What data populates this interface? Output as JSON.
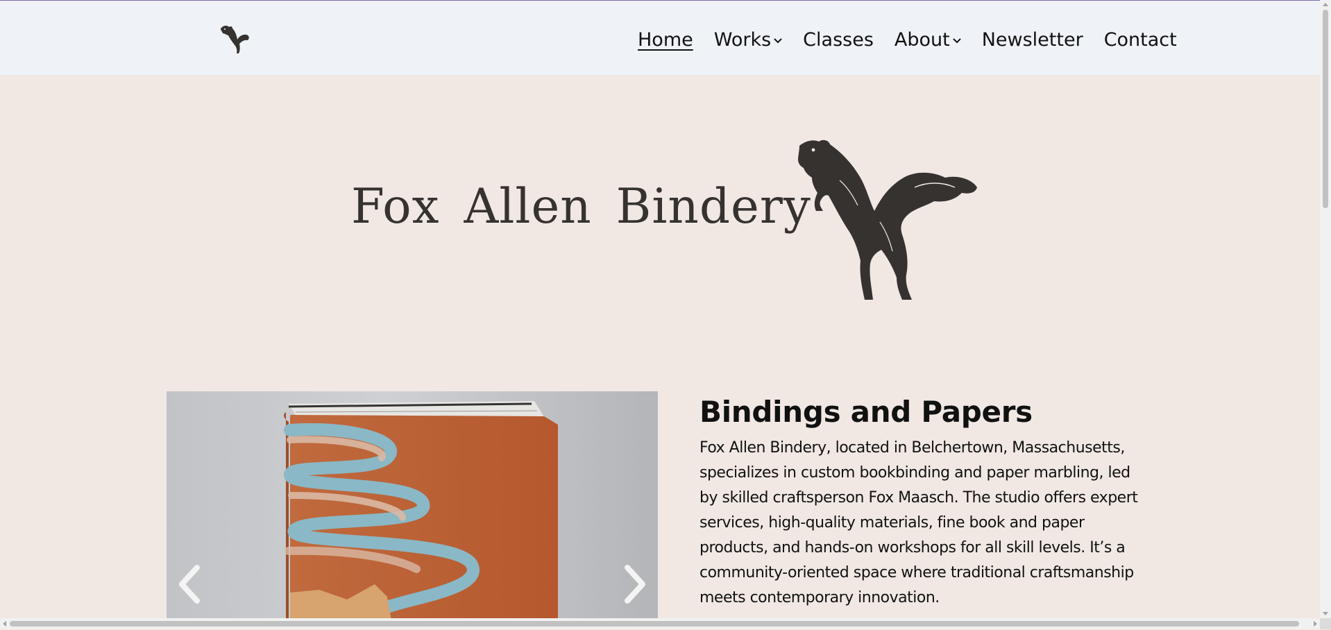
{
  "header": {
    "logo_icon": "leaping-fox-icon",
    "nav": [
      {
        "label": "Home",
        "active": true,
        "has_dropdown": false
      },
      {
        "label": "Works",
        "active": false,
        "has_dropdown": true
      },
      {
        "label": "Classes",
        "active": false,
        "has_dropdown": false
      },
      {
        "label": "About",
        "active": false,
        "has_dropdown": true
      },
      {
        "label": "Newsletter",
        "active": false,
        "has_dropdown": false
      },
      {
        "label": "Contact",
        "active": false,
        "has_dropdown": false
      }
    ]
  },
  "hero": {
    "title": "Fox Allen Bindery",
    "logo_icon": "leaping-fox-icon"
  },
  "carousel": {
    "prev_icon": "chevron-left-icon",
    "next_icon": "chevron-right-icon"
  },
  "intro": {
    "heading": "Bindings and Papers",
    "body": "Fox Allen Bindery, located in Belchertown, Massachusetts, specializes in custom bookbinding and paper marbling, led by skilled craftsperson Fox Maasch. The studio offers expert services, high-quality materials, fine book and paper products, and hands-on workshops for all skill levels. It’s a community-oriented space where traditional craftsmanship meets contemporary innovation."
  },
  "colors": {
    "header_bg": "#eff2f7",
    "page_bg": "#f1e8e3",
    "logo_ink": "#353230",
    "accent_line": "#7a67b5"
  }
}
